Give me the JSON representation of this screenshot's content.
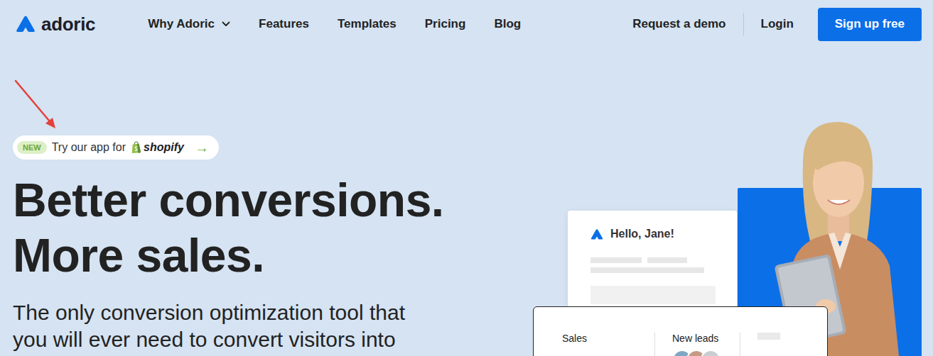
{
  "nav": {
    "logo": "adoric",
    "links": [
      {
        "label": "Why Adoric",
        "has_dropdown": true
      },
      {
        "label": "Features",
        "has_dropdown": false
      },
      {
        "label": "Templates",
        "has_dropdown": false
      },
      {
        "label": "Pricing",
        "has_dropdown": false
      },
      {
        "label": "Blog",
        "has_dropdown": false
      }
    ],
    "request_demo": "Request a demo",
    "login": "Login",
    "signup": "Sign up free"
  },
  "badge": {
    "tag": "NEW",
    "text": "Try our app for",
    "brand": "shopify",
    "arrow": "→"
  },
  "hero": {
    "title_lines": [
      "Better conversions.",
      "More sales."
    ],
    "subtitle_lines": [
      "The only conversion optimization tool that",
      "you will ever need to convert visitors into"
    ]
  },
  "illustration": {
    "greeting": "Hello, Jane!",
    "stats": [
      {
        "label": "Sales"
      },
      {
        "label": "New leads"
      }
    ]
  }
}
